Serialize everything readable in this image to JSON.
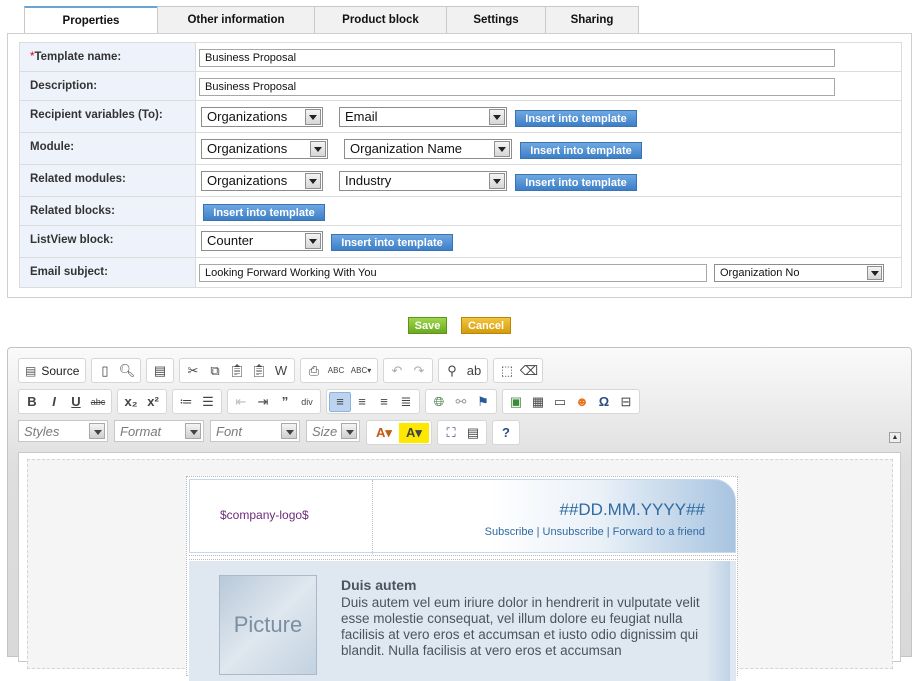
{
  "tabs": [
    {
      "label": "Properties",
      "active": true
    },
    {
      "label": "Other information",
      "active": false
    },
    {
      "label": "Product block",
      "active": false
    },
    {
      "label": "Settings",
      "active": false
    },
    {
      "label": "Sharing",
      "active": false
    }
  ],
  "form": {
    "required_marker": "*",
    "template_name": {
      "label": "Template name:",
      "value": "Business Proposal"
    },
    "description": {
      "label": "Description:",
      "value": "Business Proposal"
    },
    "recipient": {
      "label": "Recipient variables (To):",
      "select1": "Organizations",
      "select2": "Email",
      "button": "Insert into template"
    },
    "module": {
      "label": "Module:",
      "select1": "Organizations",
      "select2": "Organization Name",
      "button": "Insert into template"
    },
    "related_modules": {
      "label": "Related modules:",
      "select1": "Organizations",
      "select2": "Industry",
      "button": "Insert into template"
    },
    "related_blocks": {
      "label": "Related blocks:",
      "button": "Insert into template"
    },
    "listview_block": {
      "label": "ListView block:",
      "select1": "Counter",
      "button": "Insert into template"
    },
    "email_subject": {
      "label": "Email subject:",
      "value": "Looking Forward Working With You",
      "select": "Organization No"
    }
  },
  "actions": {
    "save": "Save",
    "cancel": "Cancel"
  },
  "editor": {
    "toolbar": {
      "source_label": "Source",
      "styles": "Styles",
      "format": "Format",
      "font": "Font",
      "size": "Size"
    },
    "template": {
      "logo": "$company-logo$",
      "date": "##DD.MM.YYYY##",
      "link_subscribe": "Subscribe",
      "link_unsubscribe": "Unsubscribe",
      "link_forward": "Forward to a friend",
      "link_sep": " | ",
      "picture": "Picture",
      "article_title": "Duis autem",
      "article_text": "Duis autem vel eum iriure dolor in hendrerit in vulputate velit esse molestie consequat, vel illum dolore eu feugiat nulla facilisis at vero eros et accumsan et iusto odio dignissim qui blandit. Nulla facilisis at vero eros et accumsan"
    }
  }
}
